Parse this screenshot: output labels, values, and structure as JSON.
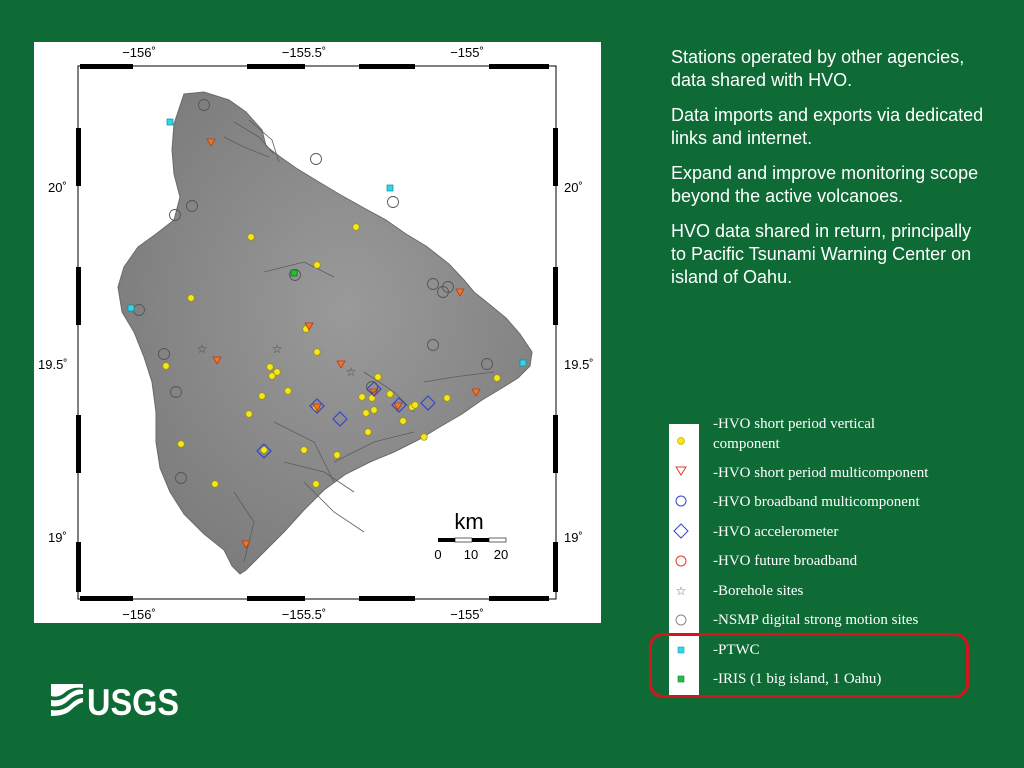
{
  "map": {
    "lon_labels": [
      "−156˚",
      "−155.5˚",
      "−155˚"
    ],
    "lat_labels": [
      "20˚",
      "19.5˚",
      "19˚"
    ],
    "scale": {
      "unit": "km",
      "ticks": [
        "0",
        "10",
        "20"
      ]
    }
  },
  "bullets": [
    "Stations operated by other agencies, data shared with HVO.",
    "Data imports and exports via dedicated links and internet.",
    "Expand and improve monitoring scope beyond the active volcanoes.",
    "HVO data shared in return, principally to Pacific Tsunami Warning Center on island of Oahu."
  ],
  "legend": [
    {
      "label": "-HVO short period vertical component",
      "icon": "yellow-dot-icon",
      "color": "#f5e619"
    },
    {
      "label": "-HVO short period multicomponent",
      "icon": "red-triangle-icon",
      "color": "#e23b2e"
    },
    {
      "label": "-HVO broadband multicomponent",
      "icon": "blue-circle-icon",
      "color": "#3546c8"
    },
    {
      "label": "-HVO accelerometer",
      "icon": "blue-diamond-icon",
      "color": "#3546c8"
    },
    {
      "label": "-HVO future broadband",
      "icon": "red-circle-icon",
      "color": "#e23b2e"
    },
    {
      "label": "-Borehole sites",
      "icon": "star-icon",
      "color": "#666666"
    },
    {
      "label": "-NSMP digital strong motion sites",
      "icon": "gray-circle-icon",
      "color": "#888888"
    },
    {
      "label": "-PTWC",
      "icon": "cyan-square-icon",
      "color": "#2fd8e8"
    },
    {
      "label": "-IRIS (1 big island, 1 Oahu)",
      "icon": "green-square-icon",
      "color": "#25c02c"
    }
  ],
  "logo": {
    "text": "USGS"
  },
  "colors": {
    "background": "#0e6b35",
    "highlight": "#d4151f",
    "terrain": "#8c8c8c"
  }
}
